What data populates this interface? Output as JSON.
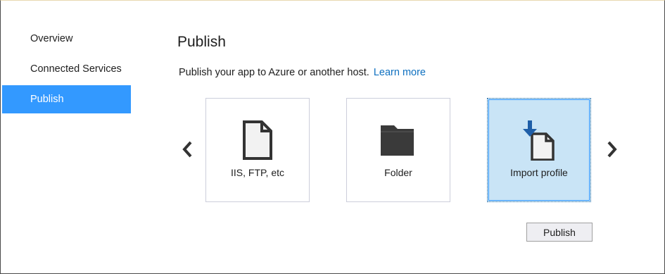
{
  "sidebar": {
    "items": [
      {
        "label": "Overview",
        "active": false
      },
      {
        "label": "Connected Services",
        "active": false
      },
      {
        "label": "Publish",
        "active": true
      }
    ]
  },
  "main": {
    "title": "Publish",
    "subtitle": "Publish your app to Azure or another host.",
    "learn_more": "Learn more",
    "targets": [
      {
        "label": "IIS, FTP, etc",
        "icon": "document-icon",
        "selected": false
      },
      {
        "label": "Folder",
        "icon": "folder-icon",
        "selected": false
      },
      {
        "label": "Import profile",
        "icon": "import-profile-icon",
        "selected": true
      }
    ],
    "publish_button": "Publish"
  },
  "colors": {
    "accent": "#3399ff",
    "link": "#0e70c0",
    "selected_tile": "#c9e4f6"
  }
}
